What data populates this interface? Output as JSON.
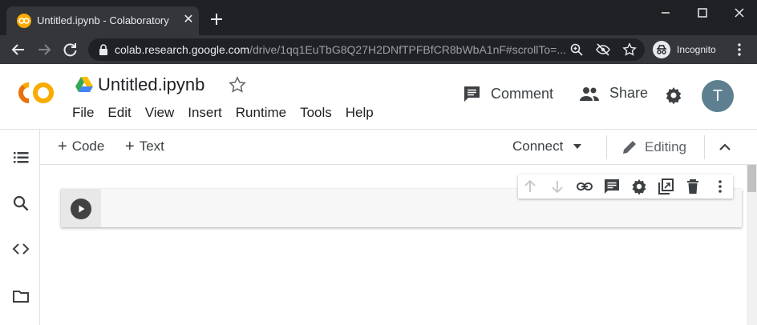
{
  "browser": {
    "tab_title": "Untitled.ipynb - Colaboratory",
    "url_host": "colab.research.google.com",
    "url_path": "/drive/1qq1EuTbG8Q27H2DNfTPFBfCR8bWbA1nF#scrollTo=...",
    "incognito_label": "Incognito"
  },
  "colab": {
    "logo_text": "CO",
    "notebook_title": "Untitled.ipynb",
    "menu": [
      "File",
      "Edit",
      "View",
      "Insert",
      "Runtime",
      "Tools",
      "Help"
    ],
    "comment_label": "Comment",
    "share_label": "Share",
    "avatar_initial": "T"
  },
  "notebook_toolbar": {
    "add_code_label": "Code",
    "add_text_label": "Text",
    "connect_label": "Connect",
    "editing_label": "Editing"
  },
  "colors": {
    "accent_orange": "#f9ab00",
    "logo_orange": "#e8710a",
    "avatar_bg": "#5d7f8f",
    "chrome_dark": "#202124"
  }
}
